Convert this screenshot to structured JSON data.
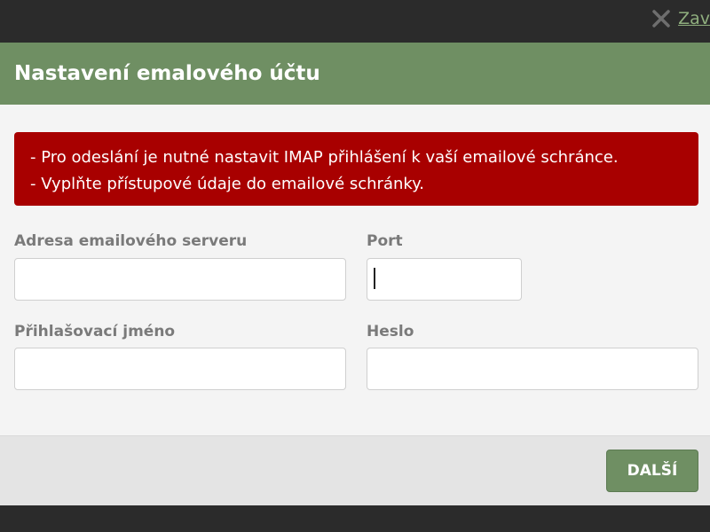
{
  "topbar": {
    "close_label": "Zav",
    "close_icon": "close-icon"
  },
  "dialog": {
    "title": "Nastavení emalového účtu",
    "errors": [
      "- Pro odeslání je nutné nastavit IMAP přihlášení k vaší emailové schránce.",
      "- Vyplňte přístupové údaje do emailové schránky."
    ],
    "fields": {
      "server": {
        "label": "Adresa emailového serveru",
        "value": ""
      },
      "port": {
        "label": "Port",
        "value": ""
      },
      "login": {
        "label": "Přihlašovací jméno",
        "value": ""
      },
      "password": {
        "label": "Heslo",
        "value": ""
      }
    },
    "next_label": "DALŠÍ"
  },
  "colors": {
    "header_green": "#6f8f63",
    "error_red": "#a80000",
    "link_green": "#8fae7e"
  }
}
